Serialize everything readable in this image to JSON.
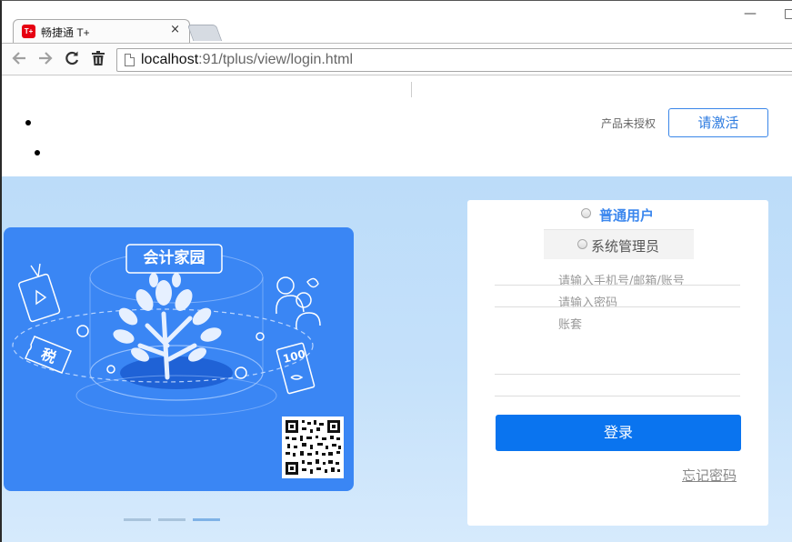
{
  "browser": {
    "tab_title": "畅捷通 T+",
    "tab_icon_text": "T+",
    "tab_close": "×",
    "window_minimize": "—",
    "window_maximize": "□",
    "url_host": "localhost",
    "url_rest": ":91/tplus/view/login.html",
    "nav": {
      "back": "←",
      "forward": "→",
      "reload": "C",
      "delete": "🗑"
    }
  },
  "header": {
    "license_status": "产品未授权",
    "activate_label": "请激活"
  },
  "banner": {
    "title": "会计家园",
    "tax_label": "税",
    "voucher_label": "100",
    "carousel": {
      "count": 3,
      "active_index": 2
    }
  },
  "login": {
    "role_user_label": "普通用户",
    "role_admin_label": "系统管理员",
    "account_placeholder": "请输入手机号/邮箱/账号",
    "password_placeholder": "请输入密码",
    "ledger_label": "账套",
    "submit_label": "登录",
    "forgot_label": "忘记密码"
  },
  "colors": {
    "accent": "#0a74ef",
    "link_blue": "#3b87ee",
    "banner_blue": "#3a86f4",
    "hero_bg": "#bcdcf9"
  }
}
